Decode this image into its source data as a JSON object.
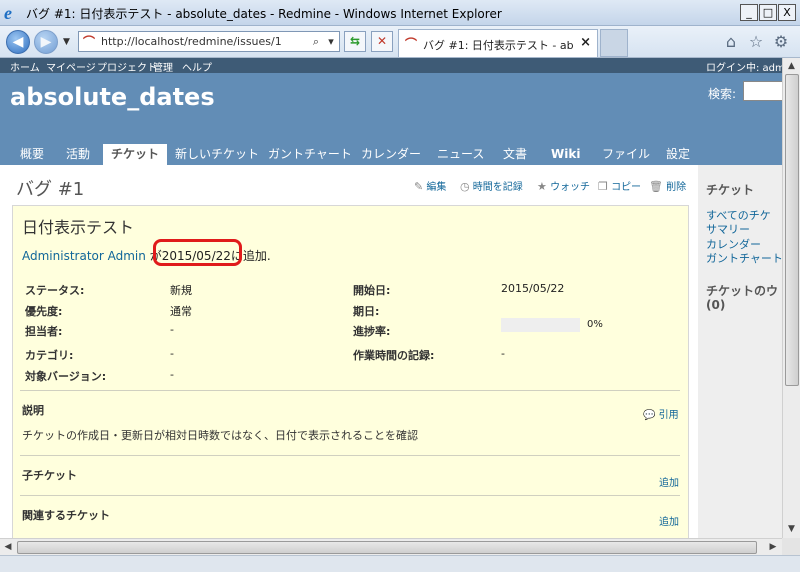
{
  "window": {
    "title": "バグ #1: 日付表示テスト - absolute_dates - Redmine - Windows Internet Explorer",
    "buttons": {
      "minimize": "_",
      "maximize": "□",
      "close": "X"
    }
  },
  "browser": {
    "url": "http://localhost/redmine/issues/1",
    "tab_title": "バグ #1: 日付表示テスト - ab...",
    "tab_close": "×"
  },
  "topmenu": {
    "items": [
      "ホーム",
      "マイページ",
      "プロジェクト",
      "管理",
      "ヘルプ"
    ],
    "loggedas": "ログイン中: adm"
  },
  "project": {
    "name": "absolute_dates",
    "search_label": "検索:"
  },
  "mainmenu": {
    "tabs": [
      "概要",
      "活動",
      "チケット",
      "新しいチケット",
      "ガントチャート",
      "カレンダー",
      "ニュース",
      "文書",
      "Wiki",
      "ファイル",
      "設定"
    ]
  },
  "issue": {
    "heading": "バグ #1",
    "actions": {
      "edit": "編集",
      "log_time": "時間を記録",
      "watch": "ウォッチ",
      "copy": "コピー",
      "delete": "削除"
    },
    "subject": "日付表示テスト",
    "author": "Administrator Admin",
    "author_particle": "が",
    "created": "2015/05/22",
    "added_suffix": "に追加.",
    "attributes": {
      "status_label": "ステータス:",
      "status": "新規",
      "priority_label": "優先度:",
      "priority": "通常",
      "assignee_label": "担当者:",
      "assignee": "-",
      "category_label": "カテゴリ:",
      "category": "-",
      "version_label": "対象バージョン:",
      "version": "-",
      "start_label": "開始日:",
      "start": "2015/05/22",
      "due_label": "期日:",
      "done_label": "進捗率:",
      "done": "0%",
      "done_value": 0,
      "spent_label": "作業時間の記録:",
      "spent": "-"
    },
    "description_label": "説明",
    "quote": "引用",
    "description": "チケットの作成日・更新日が相対日時数ではなく、日付で表示されることを確認",
    "subtasks_label": "子チケット",
    "relations_label": "関連するチケット",
    "add": "追加"
  },
  "sidebar": {
    "heading": "チケット",
    "links": [
      "すべてのチケ",
      "サマリー",
      "カレンダー",
      "ガントチャート"
    ],
    "watched_heading": "チケットのウ",
    "watched_count": "(0)"
  },
  "colors": {
    "header": "#628db6",
    "topmenu": "#3e5b76",
    "issue_bg": "#ffffdd",
    "link": "#116699",
    "highlight": "#e01b1b"
  }
}
